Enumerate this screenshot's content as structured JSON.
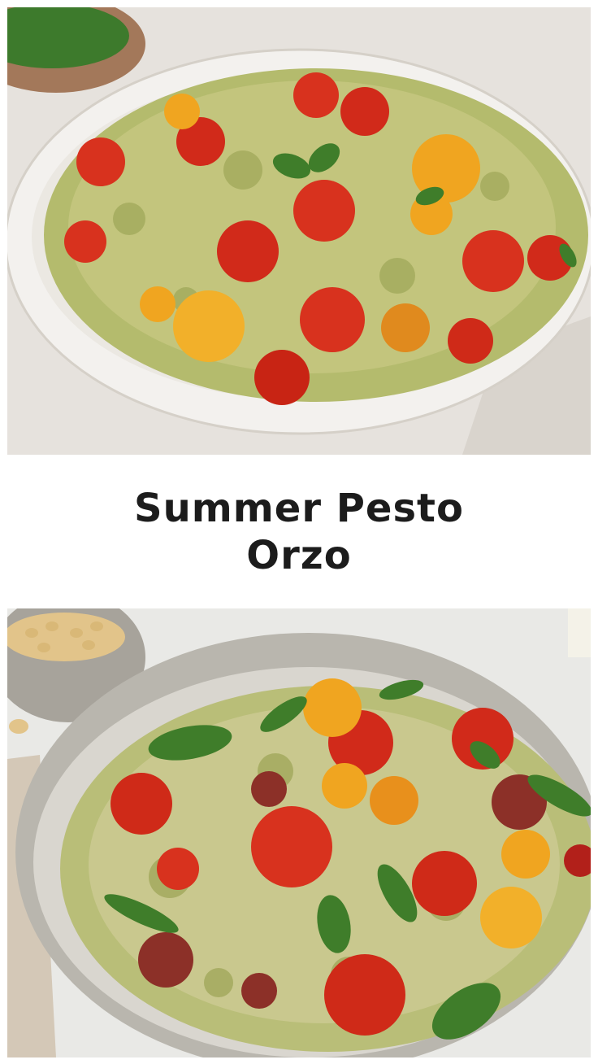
{
  "pin": {
    "title": "Summer Pesto Orzo",
    "images": [
      {
        "name": "top-photo",
        "subject": "pesto-orzo-plate-with-tomatoes-and-basil"
      },
      {
        "name": "bottom-photo",
        "subject": "pesto-orzo-bowl-with-tomatoes-basil-and-pine-nuts"
      }
    ]
  },
  "colors": {
    "background": "#ffffff",
    "title": "#1c1c1c",
    "pesto": "#b6bd6a",
    "tomato_red": "#d8321e",
    "tomato_yellow": "#f0a520",
    "basil": "#3f7d2a"
  }
}
